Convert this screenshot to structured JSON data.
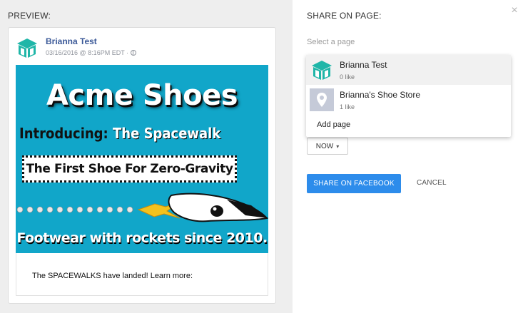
{
  "preview": {
    "label": "PREVIEW:",
    "author": "Brianna Test",
    "timestamp": "03/16/2016 @ 8:16PM EDT ·",
    "ad": {
      "title": "Acme Shoes",
      "intro_prefix": "Introducing: ",
      "intro_highlight": "The Spacewalk",
      "box_text": "The First Shoe For Zero-Gravity",
      "tagline": "Footwear with rockets since 2010."
    },
    "caption": "The SPACEWALKS have landed! Learn more:"
  },
  "share": {
    "label": "SHARE ON PAGE:",
    "select_placeholder": "Select a page",
    "pages": [
      {
        "name": "Brianna Test",
        "likes": "0 like",
        "icon": "box-logo-icon",
        "selected": true
      },
      {
        "name": "Brianna's Shoe Store",
        "likes": "1 like",
        "icon": "map-pin-icon",
        "selected": false
      }
    ],
    "add_page": "Add page",
    "schedule": "NOW",
    "share_button": "SHARE ON FACEBOOK",
    "cancel_button": "CANCEL"
  },
  "colors": {
    "accent": "#2d8ceb",
    "ad_background": "#11a6c9",
    "author_link": "#3b5998",
    "logo_teal": "#1fb6a8"
  }
}
